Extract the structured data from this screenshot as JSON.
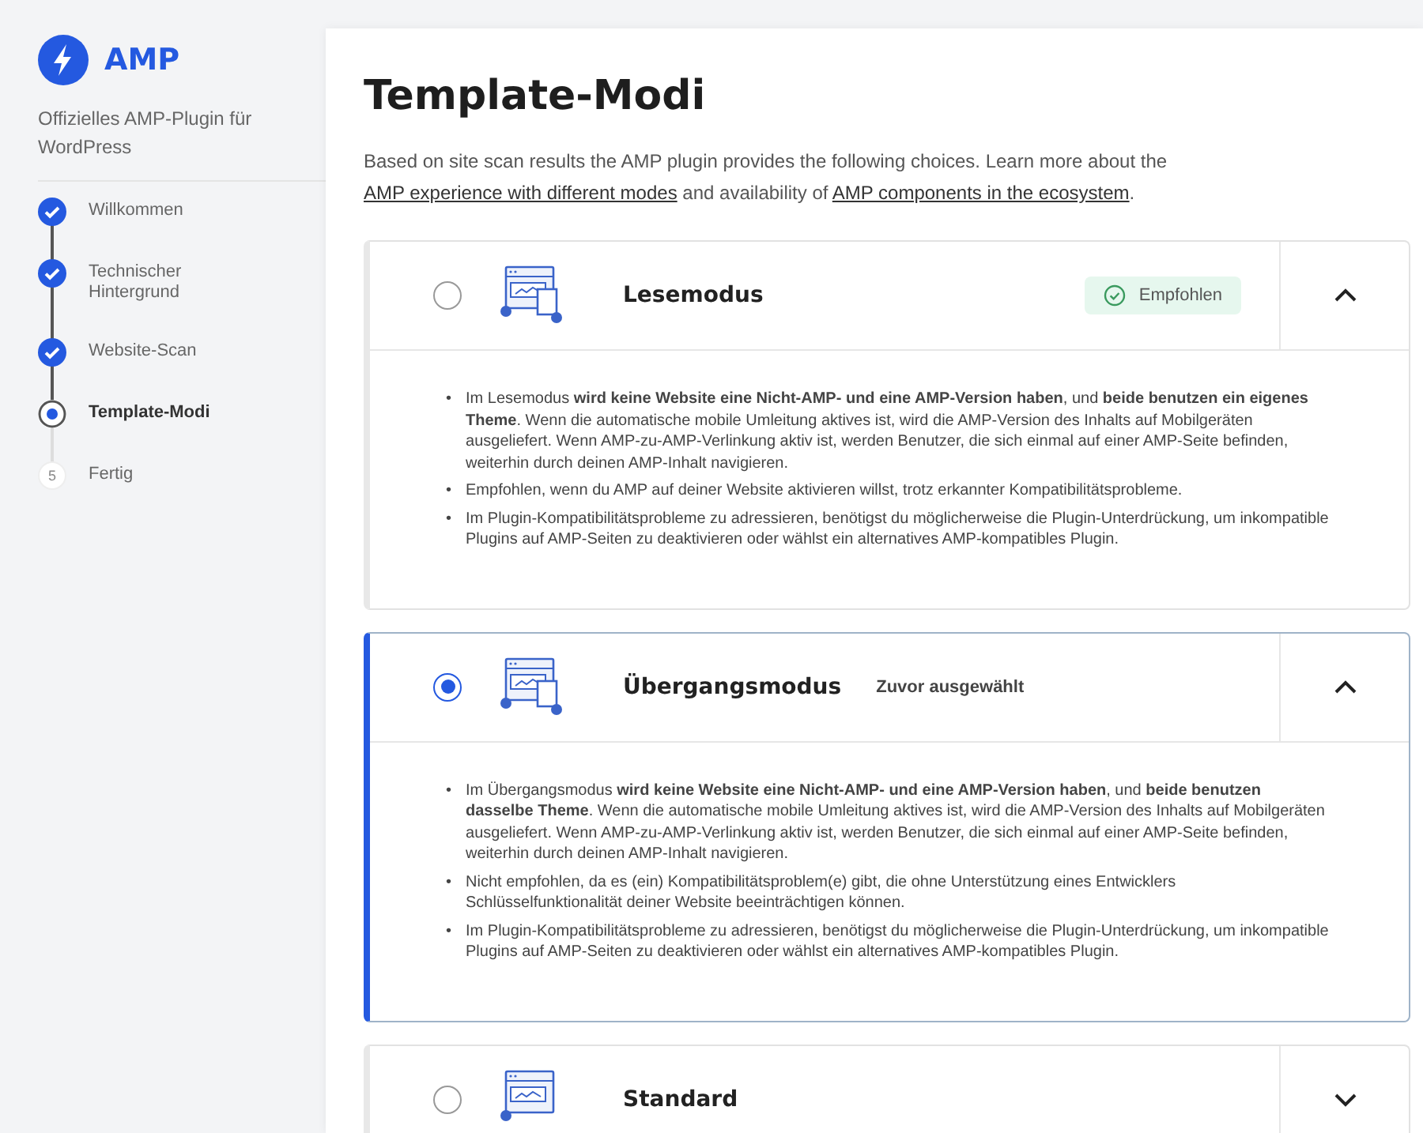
{
  "brand": {
    "name": "AMP",
    "subtitle": "Offizielles AMP-Plugin für WordPress"
  },
  "steps": [
    {
      "label": "Willkommen",
      "completed": true,
      "selected": false
    },
    {
      "label": "Technischer Hintergrund",
      "completed": true,
      "selected": false
    },
    {
      "label": "Website-Scan",
      "completed": true,
      "selected": false
    },
    {
      "label": "Template-Modi",
      "completed": false,
      "selected": true
    },
    {
      "label": "Fertig",
      "completed": false,
      "selected": false,
      "number": "5"
    }
  ],
  "bullet_marker": "•",
  "page": {
    "title": "Template-Modi",
    "intro": [
      {
        "kind": "text",
        "text": "Based on site scan results the AMP plugin provides the following choices. Learn more about the"
      },
      {
        "kind": "link",
        "text": "AMP experience with different modes"
      },
      {
        "kind": "text",
        "text": "and availability of"
      },
      {
        "kind": "link",
        "text": "AMP components in the ecosystem"
      },
      {
        "kind": "text",
        "text": "."
      }
    ]
  },
  "modes": [
    {
      "title": "Lesemodus",
      "selected": false,
      "expanded": true,
      "badge": {
        "kind": "recommended",
        "text": "Empfohlen"
      },
      "bullets": [
        "Im Lesemodus **wird keine Website eine Nicht-AMP- und eine AMP-Version haben**, und **beide benutzen ein eigenes Theme**. Wenn die automatische mobile Umleitung aktives ist, wird die AMP-Version des Inhalts auf Mobilgeräten ausgeliefert. Wenn AMP-zu-AMP-Verlinkung aktiv ist, werden Benutzer, die sich einmal auf einer AMP-Seite befinden, weiterhin durch deinen AMP-Inhalt navigieren.",
        "Empfohlen, wenn du AMP auf deiner Website aktivieren willst, trotz erkannter Kompatibilitätsprobleme.",
        "Im Plugin-Kompatibilitätsprobleme zu adressieren, benötigst du möglicherweise die Plugin-Unterdrückung, um inkompatible Plugins auf AMP-Seiten zu deaktivieren oder wählst ein alternatives AMP-kompatibles Plugin."
      ]
    },
    {
      "title": "Übergangsmodus",
      "selected": true,
      "expanded": true,
      "badge": {
        "kind": "note",
        "text": "Zuvor ausgewählt"
      },
      "bullets": [
        "Im Übergangsmodus **wird keine Website eine Nicht-AMP- und eine AMP-Version haben**, und **beide benutzen dasselbe Theme**. Wenn die automatische mobile Umleitung aktives ist, wird die AMP-Version des Inhalts auf Mobilgeräten ausgeliefert. Wenn AMP-zu-AMP-Verlinkung aktiv ist, werden Benutzer, die sich einmal auf einer AMP-Seite befinden, weiterhin durch deinen AMP-Inhalt navigieren.",
        "Nicht empfohlen, da es (ein) Kompatibilitätsproblem(e) gibt, die ohne Unterstützung eines Entwicklers Schlüsselfunktionalität deiner Website beeinträchtigen können.",
        "Im Plugin-Kompatibilitätsprobleme zu adressieren, benötigst du möglicherweise die Plugin-Unterdrückung, um inkompatible Plugins auf AMP-Seiten zu deaktivieren oder wählst ein alternatives AMP-kompatibles Plugin."
      ]
    },
    {
      "title": "Standard",
      "selected": false,
      "expanded": false
    }
  ]
}
